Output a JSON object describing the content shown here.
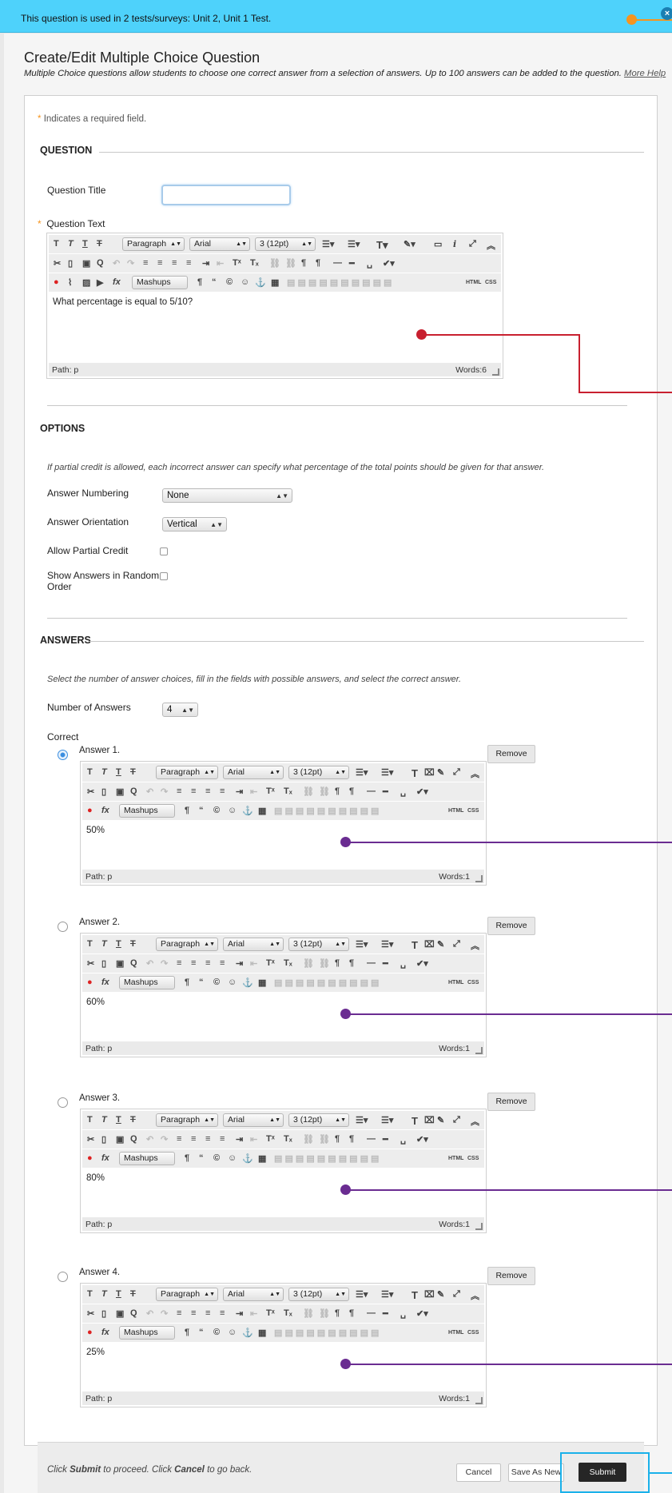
{
  "banner": {
    "text": "This question is used in 2 tests/surveys: Unit 2, Unit 1 Test.",
    "close_glyph": "×"
  },
  "header": {
    "title": "Create/Edit Multiple Choice Question",
    "description": "Multiple Choice questions allow students to choose one correct answer from a selection of answers. Up to 100 answers can be added to the question.",
    "more_help": "More Help"
  },
  "required_note": {
    "star": "*",
    "text": "Indicates a required field."
  },
  "question": {
    "section_title": "QUESTION",
    "title_label": "Question Title",
    "title_value": "",
    "text_label": "Question Text",
    "text_value": "What percentage is equal to 5/10?",
    "path": "Path: p",
    "words": "Words:6"
  },
  "editor_toolbar": {
    "format": "Paragraph",
    "font": "Arial",
    "size": "3 (12pt)",
    "mashups": "Mashups",
    "html": "HTML",
    "css": "CSS"
  },
  "options": {
    "section_title": "OPTIONS",
    "help": "If partial credit is allowed, each incorrect answer can specify what percentage of the total points should be given for that answer.",
    "numbering_label": "Answer Numbering",
    "numbering_value": "None",
    "orientation_label": "Answer Orientation",
    "orientation_value": "Vertical",
    "partial_credit_label": "Allow Partial Credit",
    "random_order_label_1": "Show Answers in Random",
    "random_order_label_2": "Order"
  },
  "answers": {
    "section_title": "ANSWERS",
    "help": "Select the number of answer choices, fill in the fields with possible answers, and select the correct answer.",
    "count_label": "Number of Answers",
    "count_value": "4",
    "correct_label": "Correct",
    "remove_label": "Remove",
    "items": [
      {
        "label": "Answer 1.",
        "value": "50%",
        "path": "Path: p",
        "words": "Words:1",
        "correct": true
      },
      {
        "label": "Answer 2.",
        "value": "60%",
        "path": "Path: p",
        "words": "Words:1",
        "correct": false
      },
      {
        "label": "Answer 3.",
        "value": "80%",
        "path": "Path: p",
        "words": "Words:1",
        "correct": false
      },
      {
        "label": "Answer 4.",
        "value": "25%",
        "path": "Path: p",
        "words": "Words:1",
        "correct": false
      }
    ]
  },
  "footer": {
    "text_pre": "Click ",
    "text_submit": "Submit",
    "text_mid": " to proceed. Click ",
    "text_cancel": "Cancel",
    "text_post": " to go back.",
    "cancel_label": "Cancel",
    "save_as_new_label": "Save As New",
    "submit_label": "Submit"
  },
  "colors": {
    "banner": "#4ed2fb",
    "question_annotation": "#c8202f",
    "answer_annotation": "#6a2c91",
    "submit_highlight": "#1ab1ea",
    "banner_annotation": "#f6941d"
  }
}
